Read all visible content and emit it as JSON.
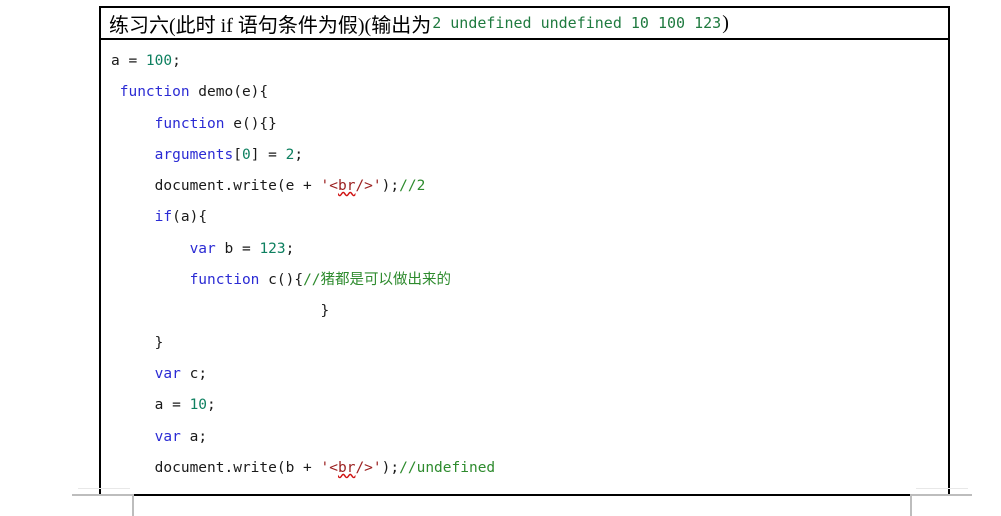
{
  "document": {
    "title_prefix": "练习六(此时 if 语句条件为假)(输出为 ",
    "title_output": "2 undefined undefined 10 100 123",
    "title_suffix": " )",
    "exercise_name": "练习六",
    "condition_note": "(此时 if 语句条件为假)",
    "output_label": "(输出为",
    "output_values": [
      "2",
      "undefined",
      "undefined",
      "10",
      "100",
      "123"
    ]
  },
  "colors": {
    "keyword": "#2b2bd4",
    "number": "#0e8060",
    "string": "#9b2020",
    "comment": "#2e8b2e",
    "plain": "#1a1a1a",
    "output_green": "#1f7a3f",
    "border": "#000000",
    "spell_underline": "#d01010"
  },
  "code": {
    "language": "javascript",
    "lines": [
      {
        "n": 1,
        "indent": 1,
        "text": "a = 100;",
        "tokens": [
          {
            "t": "a = ",
            "k": "plain"
          },
          {
            "t": "100",
            "k": "num"
          },
          {
            "t": ";",
            "k": "plain"
          }
        ]
      },
      {
        "n": 2,
        "indent": 1,
        "text": " function demo(e){",
        "tokens": [
          {
            "t": " ",
            "k": "plain"
          },
          {
            "t": "function",
            "k": "kw"
          },
          {
            "t": " demo(e){",
            "k": "plain"
          }
        ]
      },
      {
        "n": 3,
        "indent": 3,
        "text": "     function e(){}",
        "tokens": [
          {
            "t": "     ",
            "k": "plain"
          },
          {
            "t": "function",
            "k": "kw"
          },
          {
            "t": " e(){}",
            "k": "plain"
          }
        ]
      },
      {
        "n": 4,
        "indent": 3,
        "text": "     arguments[0] = 2;",
        "tokens": [
          {
            "t": "     ",
            "k": "plain"
          },
          {
            "t": "arguments",
            "k": "kw"
          },
          {
            "t": "[",
            "k": "plain"
          },
          {
            "t": "0",
            "k": "num"
          },
          {
            "t": "] = ",
            "k": "plain"
          },
          {
            "t": "2",
            "k": "num"
          },
          {
            "t": ";",
            "k": "plain"
          }
        ]
      },
      {
        "n": 5,
        "indent": 3,
        "text": "     document.write(e + '<br/>');//2",
        "tokens": [
          {
            "t": "     document.write(e + ",
            "k": "plain"
          },
          {
            "t": "'<",
            "k": "str"
          },
          {
            "t": "br",
            "k": "str-spell"
          },
          {
            "t": "/>'",
            "k": "str"
          },
          {
            "t": ");",
            "k": "plain"
          },
          {
            "t": "//2",
            "k": "com"
          }
        ]
      },
      {
        "n": 6,
        "indent": 3,
        "text": "     if(a){",
        "tokens": [
          {
            "t": "     ",
            "k": "plain"
          },
          {
            "t": "if",
            "k": "kw"
          },
          {
            "t": "(a){",
            "k": "plain"
          }
        ]
      },
      {
        "n": 7,
        "indent": 5,
        "text": "         var b = 123;",
        "tokens": [
          {
            "t": "         ",
            "k": "plain"
          },
          {
            "t": "var",
            "k": "kw"
          },
          {
            "t": " b = ",
            "k": "plain"
          },
          {
            "t": "123",
            "k": "num"
          },
          {
            "t": ";",
            "k": "plain"
          }
        ]
      },
      {
        "n": 8,
        "indent": 5,
        "text": "         function c(){//猪都是可以做出来的",
        "tokens": [
          {
            "t": "         ",
            "k": "plain"
          },
          {
            "t": "function",
            "k": "kw"
          },
          {
            "t": " c(){",
            "k": "plain"
          },
          {
            "t": "//猪都是可以做出来的",
            "k": "com"
          }
        ]
      },
      {
        "n": 9,
        "indent": 14,
        "text": "                        }",
        "tokens": [
          {
            "t": "                        }",
            "k": "plain"
          }
        ]
      },
      {
        "n": 10,
        "indent": 3,
        "text": "     }",
        "tokens": [
          {
            "t": "     }",
            "k": "plain"
          }
        ]
      },
      {
        "n": 11,
        "indent": 3,
        "text": "     var c;",
        "tokens": [
          {
            "t": "     ",
            "k": "plain"
          },
          {
            "t": "var",
            "k": "kw"
          },
          {
            "t": " c;",
            "k": "plain"
          }
        ]
      },
      {
        "n": 12,
        "indent": 3,
        "text": "     a = 10;",
        "tokens": [
          {
            "t": "     a = ",
            "k": "plain"
          },
          {
            "t": "10",
            "k": "num"
          },
          {
            "t": ";",
            "k": "plain"
          }
        ]
      },
      {
        "n": 13,
        "indent": 3,
        "text": "     var a;",
        "tokens": [
          {
            "t": "     ",
            "k": "plain"
          },
          {
            "t": "var",
            "k": "kw"
          },
          {
            "t": " a;",
            "k": "plain"
          }
        ]
      },
      {
        "n": 14,
        "indent": 3,
        "text": "     document.write(b + '<br/>');//undefined",
        "tokens": [
          {
            "t": "     document.write(b + ",
            "k": "plain"
          },
          {
            "t": "'<",
            "k": "str"
          },
          {
            "t": "br",
            "k": "str-spell"
          },
          {
            "t": "/>'",
            "k": "str"
          },
          {
            "t": ");",
            "k": "plain"
          },
          {
            "t": "//undefined",
            "k": "com"
          }
        ]
      }
    ]
  },
  "watermark": {
    "glyphs": [
      "",
      "",
      "",
      ""
    ]
  }
}
